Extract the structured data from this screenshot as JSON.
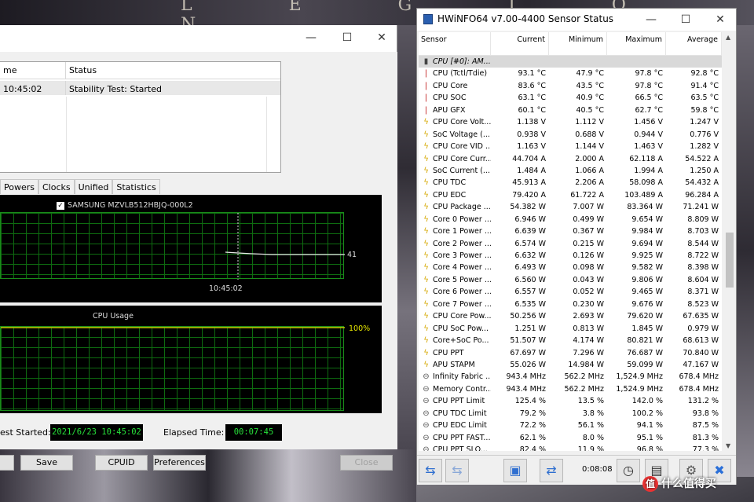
{
  "wallpaper": {
    "letters": "L E G I O N"
  },
  "stability": {
    "window_controls": {
      "minimize": "—",
      "maximize": "☐",
      "close": "✕"
    },
    "log": {
      "headers": [
        "me",
        "Status"
      ],
      "rows": [
        [
          "10:45:02",
          "Stability Test: Started"
        ]
      ]
    },
    "tabs": [
      "Powers",
      "Clocks",
      "Unified",
      "Statistics"
    ],
    "graph1": {
      "legend": "SAMSUNG MZVLB512HBJQ-000L2",
      "checked": "✓",
      "value_label": "41",
      "time_label": "10:45:02"
    },
    "graph2": {
      "title": "CPU Usage",
      "value_label": "100%"
    },
    "test_started_label": "est Started:",
    "test_started_value": "2021/6/23 10:45:02",
    "elapsed_label": "Elapsed Time:",
    "elapsed_value": "00:07:45",
    "buttons": {
      "save": "Save",
      "cpuid": "CPUID",
      "preferences": "Preferences",
      "close": "Close"
    }
  },
  "hwinfo": {
    "title": "HWiNFO64 v7.00-4400 Sensor Status",
    "window_controls": {
      "minimize": "—",
      "maximize": "☐",
      "close": "✕"
    },
    "columns": [
      "Sensor",
      "Current",
      "Minimum",
      "Maximum",
      "Average"
    ],
    "group": "CPU [#0]: AM...",
    "rows": [
      {
        "icon": "temp",
        "name": "CPU (Tctl/Tdie)",
        "cur": "93.1 °C",
        "min": "47.9 °C",
        "max": "97.8 °C",
        "avg": "92.8 °C"
      },
      {
        "icon": "temp",
        "name": "CPU Core",
        "cur": "83.6 °C",
        "min": "43.5 °C",
        "max": "97.8 °C",
        "avg": "91.4 °C"
      },
      {
        "icon": "temp",
        "name": "CPU SOC",
        "cur": "63.1 °C",
        "min": "40.9 °C",
        "max": "66.5 °C",
        "avg": "63.5 °C"
      },
      {
        "icon": "temp",
        "name": "APU GFX",
        "cur": "60.1 °C",
        "min": "40.5 °C",
        "max": "62.7 °C",
        "avg": "59.8 °C"
      },
      {
        "icon": "volt",
        "name": "CPU Core Volt...",
        "cur": "1.138 V",
        "min": "1.112 V",
        "max": "1.456 V",
        "avg": "1.247 V"
      },
      {
        "icon": "volt",
        "name": "SoC Voltage (...",
        "cur": "0.938 V",
        "min": "0.688 V",
        "max": "0.944 V",
        "avg": "0.776 V"
      },
      {
        "icon": "volt",
        "name": "CPU Core VID ...",
        "cur": "1.163 V",
        "min": "1.144 V",
        "max": "1.463 V",
        "avg": "1.282 V"
      },
      {
        "icon": "volt",
        "name": "CPU Core Curr...",
        "cur": "44.704 A",
        "min": "2.000 A",
        "max": "62.118 A",
        "avg": "54.522 A"
      },
      {
        "icon": "volt",
        "name": "SoC Current (...",
        "cur": "1.484 A",
        "min": "1.066 A",
        "max": "1.994 A",
        "avg": "1.250 A"
      },
      {
        "icon": "volt",
        "name": "CPU TDC",
        "cur": "45.913 A",
        "min": "2.206 A",
        "max": "58.098 A",
        "avg": "54.432 A"
      },
      {
        "icon": "volt",
        "name": "CPU EDC",
        "cur": "79.420 A",
        "min": "61.722 A",
        "max": "103.489 A",
        "avg": "96.284 A"
      },
      {
        "icon": "volt",
        "name": "CPU Package ...",
        "cur": "54.382 W",
        "min": "7.007 W",
        "max": "83.364 W",
        "avg": "71.241 W"
      },
      {
        "icon": "volt",
        "name": "Core 0 Power ...",
        "cur": "6.946 W",
        "min": "0.499 W",
        "max": "9.654 W",
        "avg": "8.809 W"
      },
      {
        "icon": "volt",
        "name": "Core 1 Power ...",
        "cur": "6.639 W",
        "min": "0.367 W",
        "max": "9.984 W",
        "avg": "8.703 W"
      },
      {
        "icon": "volt",
        "name": "Core 2 Power ...",
        "cur": "6.574 W",
        "min": "0.215 W",
        "max": "9.694 W",
        "avg": "8.544 W"
      },
      {
        "icon": "volt",
        "name": "Core 3 Power ...",
        "cur": "6.632 W",
        "min": "0.126 W",
        "max": "9.925 W",
        "avg": "8.722 W"
      },
      {
        "icon": "volt",
        "name": "Core 4 Power ...",
        "cur": "6.493 W",
        "min": "0.098 W",
        "max": "9.582 W",
        "avg": "8.398 W"
      },
      {
        "icon": "volt",
        "name": "Core 5 Power ...",
        "cur": "6.560 W",
        "min": "0.043 W",
        "max": "9.806 W",
        "avg": "8.604 W"
      },
      {
        "icon": "volt",
        "name": "Core 6 Power ...",
        "cur": "6.557 W",
        "min": "0.052 W",
        "max": "9.465 W",
        "avg": "8.371 W"
      },
      {
        "icon": "volt",
        "name": "Core 7 Power ...",
        "cur": "6.535 W",
        "min": "0.230 W",
        "max": "9.676 W",
        "avg": "8.523 W"
      },
      {
        "icon": "volt",
        "name": "CPU Core Pow...",
        "cur": "50.256 W",
        "min": "2.693 W",
        "max": "79.620 W",
        "avg": "67.635 W"
      },
      {
        "icon": "volt",
        "name": "CPU SoC Pow...",
        "cur": "1.251 W",
        "min": "0.813 W",
        "max": "1.845 W",
        "avg": "0.979 W"
      },
      {
        "icon": "volt",
        "name": "Core+SoC Po...",
        "cur": "51.507 W",
        "min": "4.174 W",
        "max": "80.821 W",
        "avg": "68.613 W"
      },
      {
        "icon": "volt",
        "name": "CPU PPT",
        "cur": "67.697 W",
        "min": "7.296 W",
        "max": "76.687 W",
        "avg": "70.840 W"
      },
      {
        "icon": "volt",
        "name": "APU STAPM",
        "cur": "55.026 W",
        "min": "14.984 W",
        "max": "59.099 W",
        "avg": "47.167 W"
      },
      {
        "icon": "gauge",
        "name": "Infinity Fabric ...",
        "cur": "943.4 MHz",
        "min": "562.2 MHz",
        "max": "1,524.9 MHz",
        "avg": "678.4 MHz"
      },
      {
        "icon": "gauge",
        "name": "Memory Contr...",
        "cur": "943.4 MHz",
        "min": "562.2 MHz",
        "max": "1,524.9 MHz",
        "avg": "678.4 MHz"
      },
      {
        "icon": "gauge",
        "name": "CPU PPT Limit",
        "cur": "125.4 %",
        "min": "13.5 %",
        "max": "142.0 %",
        "avg": "131.2 %"
      },
      {
        "icon": "gauge",
        "name": "CPU TDC Limit",
        "cur": "79.2 %",
        "min": "3.8 %",
        "max": "100.2 %",
        "avg": "93.8 %"
      },
      {
        "icon": "gauge",
        "name": "CPU EDC Limit",
        "cur": "72.2 %",
        "min": "56.1 %",
        "max": "94.1 %",
        "avg": "87.5 %"
      },
      {
        "icon": "gauge",
        "name": "CPU PPT FAST...",
        "cur": "62.1 %",
        "min": "8.0 %",
        "max": "95.1 %",
        "avg": "81.3 %"
      },
      {
        "icon": "gauge",
        "name": "CPU PPT SLO...",
        "cur": "82.4 %",
        "min": "11.9 %",
        "max": "96.8 %",
        "avg": "77.3 %"
      }
    ],
    "timer": "0:08:08"
  },
  "watermark": {
    "badge": "值",
    "text": "什么值得买"
  },
  "icons": {
    "temp": "thermometer-icon",
    "volt": "lightning-icon",
    "gauge": "gauge-icon",
    "chip": "chip-icon"
  }
}
